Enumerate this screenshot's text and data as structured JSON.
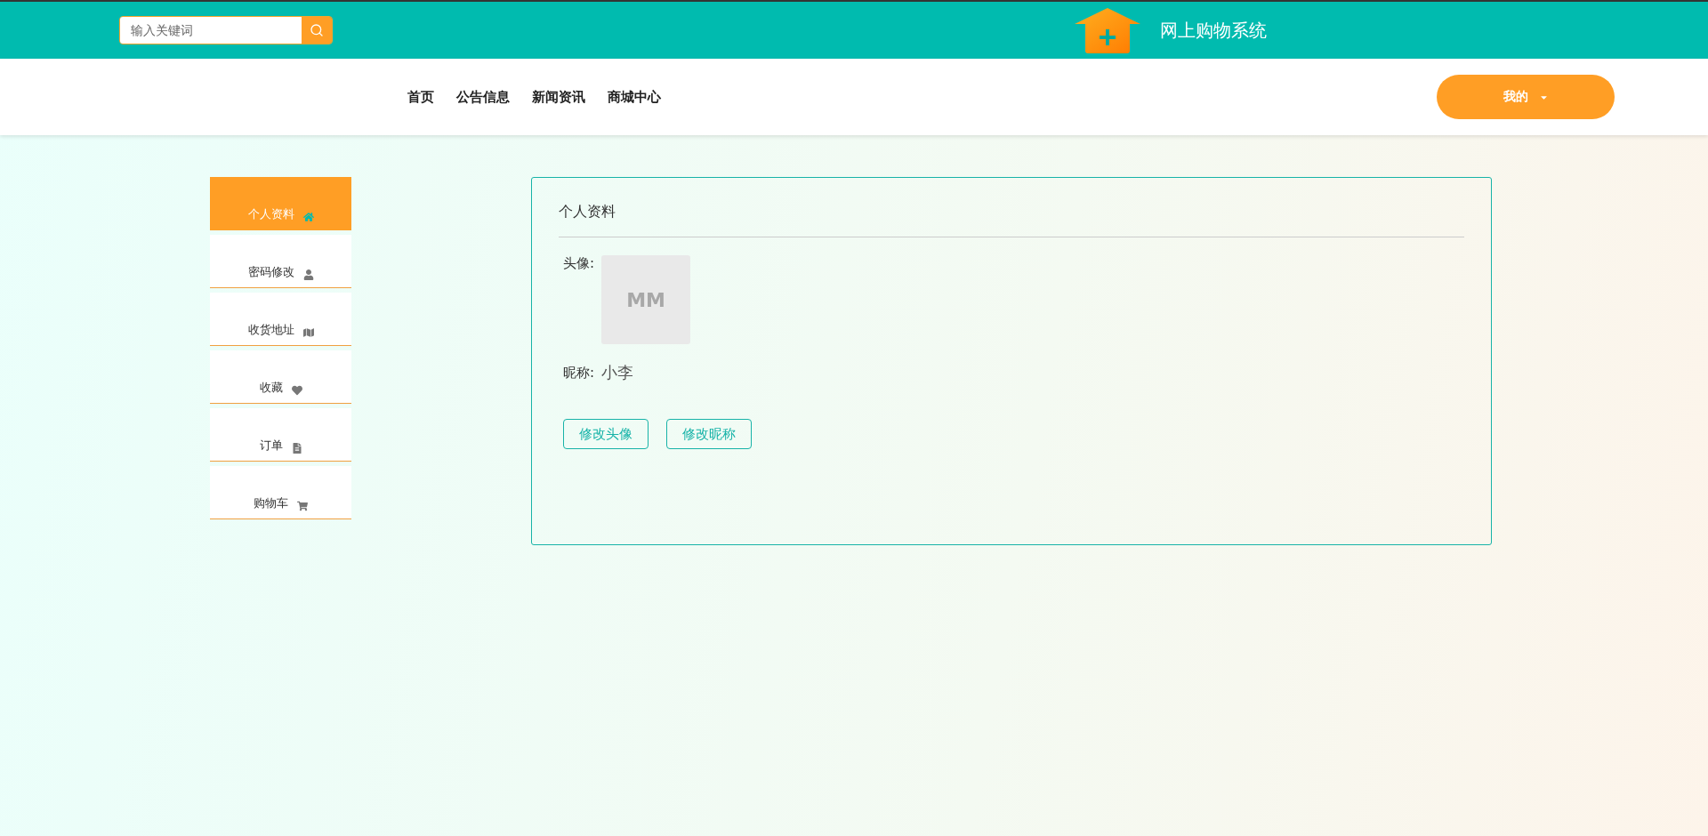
{
  "header": {
    "search": {
      "placeholder": "输入关键词"
    },
    "site_title": "网上购物系统"
  },
  "nav": {
    "links": [
      "首页",
      "公告信息",
      "新闻资讯",
      "商城中心"
    ],
    "user_menu": "我的"
  },
  "sidebar": {
    "items": [
      {
        "label": "个人资料",
        "selected": true
      },
      {
        "label": "密码修改",
        "selected": false
      },
      {
        "label": "收货地址",
        "selected": false
      },
      {
        "label": "收藏",
        "selected": false
      },
      {
        "label": "订单",
        "selected": false
      },
      {
        "label": "购物车",
        "selected": false
      }
    ]
  },
  "profile": {
    "title": "个人资料",
    "avatar_label": "头像:",
    "avatar_text": "MM",
    "nickname_label": "昵称:",
    "nickname": "小李",
    "buttons": [
      "修改头像",
      "修改昵称"
    ]
  }
}
